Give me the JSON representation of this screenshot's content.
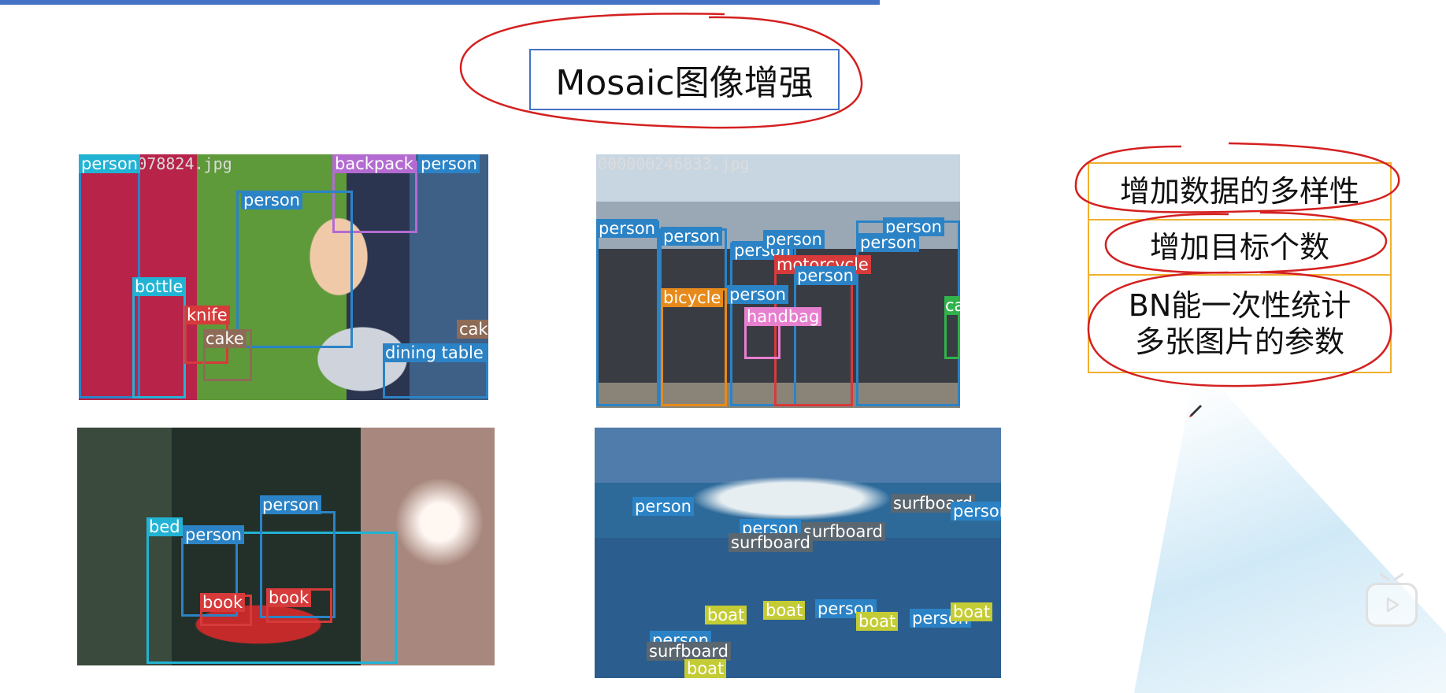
{
  "slide": {
    "title": "Mosaic图像增强"
  },
  "benefits": [
    "增加数据的多样性",
    "增加目标个数",
    "BN能一次性统计\n多张图片的参数"
  ],
  "images": [
    {
      "filename": "000000078824.jpg",
      "labels": [
        "person",
        "backpack",
        "person",
        "person",
        "bottle",
        "knife",
        "cake",
        "cake",
        "dining table"
      ]
    },
    {
      "filename": "000000246833.jpg",
      "labels": [
        "person",
        "person",
        "person",
        "person",
        "person",
        "person",
        "motorcycle",
        "person",
        "bicycle",
        "person",
        "handbag",
        "car"
      ]
    },
    {
      "filename": "",
      "labels": [
        "person",
        "bed",
        "person",
        "book",
        "book"
      ]
    },
    {
      "filename": "",
      "labels": [
        "person",
        "surfboard",
        "person",
        "person",
        "surfboard",
        "surfboard",
        "boat",
        "boat",
        "person",
        "boat",
        "person",
        "boat",
        "person",
        "surfboard",
        "boat"
      ]
    }
  ],
  "player": {
    "icon": "bilibili-play-icon"
  }
}
